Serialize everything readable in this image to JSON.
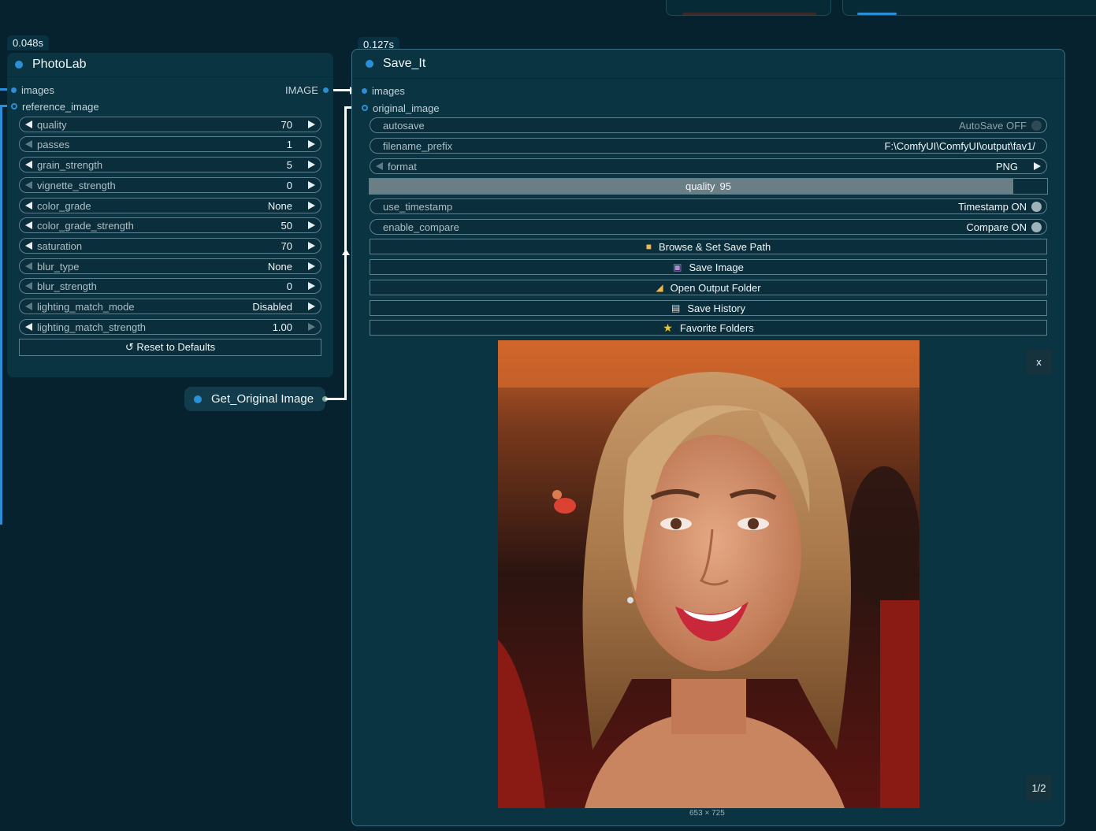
{
  "photolab": {
    "timing": "0.048s",
    "title": "PhotoLab",
    "inputs": [
      {
        "label": "images"
      },
      {
        "label": "reference_image"
      }
    ],
    "output_type": "IMAGE",
    "widgets": [
      {
        "label": "quality",
        "value": "70"
      },
      {
        "label": "passes",
        "value": "1"
      },
      {
        "label": "grain_strength",
        "value": "5"
      },
      {
        "label": "vignette_strength",
        "value": "0"
      },
      {
        "label": "color_grade",
        "value": "None"
      },
      {
        "label": "color_grade_strength",
        "value": "50"
      },
      {
        "label": "saturation",
        "value": "70"
      },
      {
        "label": "blur_type",
        "value": "None"
      },
      {
        "label": "blur_strength",
        "value": "0"
      },
      {
        "label": "lighting_match_mode",
        "value": "Disabled"
      },
      {
        "label": "lighting_match_strength",
        "value": "1.00"
      }
    ],
    "reset_button": "↺ Reset to Defaults"
  },
  "get_original": {
    "title": "Get_Original Image"
  },
  "save_it": {
    "timing": "0.127s",
    "title": "Save_It",
    "inputs": [
      {
        "label": "images"
      },
      {
        "label": "original_image"
      }
    ],
    "autosave": {
      "label": "autosave",
      "value": "AutoSave OFF"
    },
    "filename_prefix": {
      "label": "filename_prefix",
      "value": "F:\\ComfyUI\\ComfyUI\\output\\fav1/"
    },
    "format": {
      "label": "format",
      "value": "PNG"
    },
    "quality": {
      "label": "quality",
      "value": "95",
      "fraction": 0.95
    },
    "use_timestamp": {
      "label": "use_timestamp",
      "value": "Timestamp ON"
    },
    "enable_compare": {
      "label": "enable_compare",
      "value": "Compare ON"
    },
    "buttons": [
      {
        "label": "Browse & Set Save Path",
        "icon": "folder-icon"
      },
      {
        "label": "Save Image",
        "icon": "floppy-disk-icon"
      },
      {
        "label": "Open Output Folder",
        "icon": "open-folder-icon"
      },
      {
        "label": "Save History",
        "icon": "notepad-icon"
      },
      {
        "label": "Favorite Folders",
        "icon": "star-icon"
      }
    ],
    "close_label": "x",
    "pager": "1/2",
    "dimensions": "653 × 725"
  },
  "colors": {
    "canvas_bg": "#05222e",
    "node_bg": "#0b3442",
    "slot_blue": "#2b8fd7",
    "wire_white": "#ffffff"
  }
}
